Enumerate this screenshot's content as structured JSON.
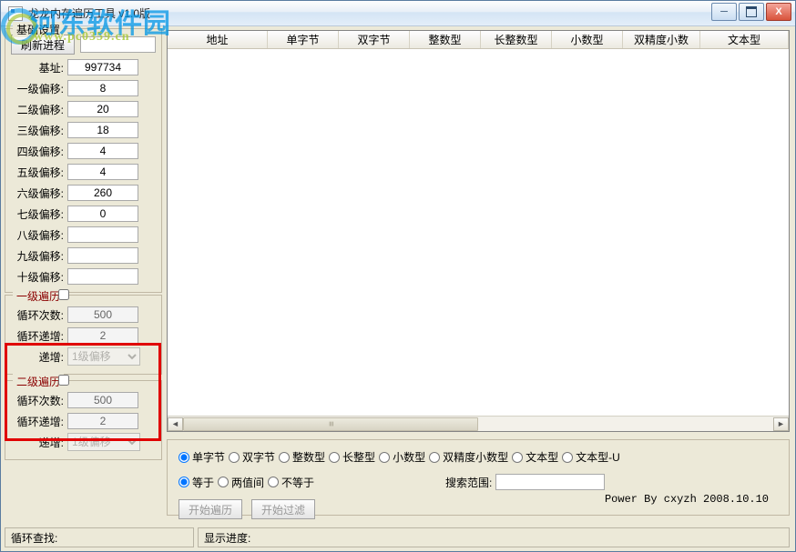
{
  "window": {
    "title": "龙龙内存遍历工具 v1.0版"
  },
  "watermark": {
    "main": "河东软件园",
    "sub": "www.pc0359.cn"
  },
  "basegroup": {
    "legend": "基础设置",
    "refresh": "刷新进程",
    "labels": {
      "base": "基址:",
      "o1": "一级偏移:",
      "o2": "二级偏移:",
      "o3": "三级偏移:",
      "o4": "四级偏移:",
      "o5": "五级偏移:",
      "o6": "六级偏移:",
      "o7": "七级偏移:",
      "o8": "八级偏移:",
      "o9": "九级偏移:",
      "o10": "十级偏移:"
    },
    "values": {
      "base": "997734",
      "o1": "8",
      "o2": "20",
      "o3": "18",
      "o4": "4",
      "o5": "4",
      "o6": "260",
      "o7": "0",
      "o8": "",
      "o9": "",
      "o10": ""
    }
  },
  "loop1": {
    "legend": "一级遍历",
    "countLabel": "循环次数:",
    "count": "500",
    "incLabel": "循环递增:",
    "inc": "2",
    "selLabel": "递增:",
    "sel": "1级偏移"
  },
  "loop2": {
    "legend": "二级遍历",
    "countLabel": "循环次数:",
    "count": "500",
    "incLabel": "循环递增:",
    "inc": "2",
    "selLabel": "递增:",
    "sel": "1级偏移"
  },
  "grid": {
    "cols": [
      "地址",
      "单字节",
      "双字节",
      "整数型",
      "长整数型",
      "小数型",
      "双精度小数",
      "文本型"
    ]
  },
  "filters": {
    "types": [
      "单字节",
      "双字节",
      "整数型",
      "长整型",
      "小数型",
      "双精度小数型",
      "文本型",
      "文本型-U"
    ],
    "ops": [
      "等于",
      "两值间",
      "不等于"
    ],
    "rangeLabel": "搜索范围:",
    "start": "开始遍历",
    "filter": "开始过滤",
    "credit": "Power By cxyzh 2008.10.10"
  },
  "status": {
    "left": "循环查找:",
    "right": "显示进度:"
  }
}
